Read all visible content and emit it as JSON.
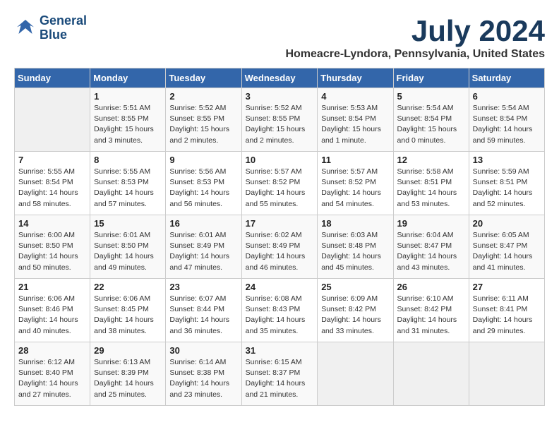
{
  "logo": {
    "line1": "General",
    "line2": "Blue"
  },
  "title": "July 2024",
  "location": "Homeacre-Lyndora, Pennsylvania, United States",
  "days_of_week": [
    "Sunday",
    "Monday",
    "Tuesday",
    "Wednesday",
    "Thursday",
    "Friday",
    "Saturday"
  ],
  "weeks": [
    [
      {
        "day": "",
        "info": ""
      },
      {
        "day": "1",
        "info": "Sunrise: 5:51 AM\nSunset: 8:55 PM\nDaylight: 15 hours\nand 3 minutes."
      },
      {
        "day": "2",
        "info": "Sunrise: 5:52 AM\nSunset: 8:55 PM\nDaylight: 15 hours\nand 2 minutes."
      },
      {
        "day": "3",
        "info": "Sunrise: 5:52 AM\nSunset: 8:55 PM\nDaylight: 15 hours\nand 2 minutes."
      },
      {
        "day": "4",
        "info": "Sunrise: 5:53 AM\nSunset: 8:54 PM\nDaylight: 15 hours\nand 1 minute."
      },
      {
        "day": "5",
        "info": "Sunrise: 5:54 AM\nSunset: 8:54 PM\nDaylight: 15 hours\nand 0 minutes."
      },
      {
        "day": "6",
        "info": "Sunrise: 5:54 AM\nSunset: 8:54 PM\nDaylight: 14 hours\nand 59 minutes."
      }
    ],
    [
      {
        "day": "7",
        "info": "Sunrise: 5:55 AM\nSunset: 8:54 PM\nDaylight: 14 hours\nand 58 minutes."
      },
      {
        "day": "8",
        "info": "Sunrise: 5:55 AM\nSunset: 8:53 PM\nDaylight: 14 hours\nand 57 minutes."
      },
      {
        "day": "9",
        "info": "Sunrise: 5:56 AM\nSunset: 8:53 PM\nDaylight: 14 hours\nand 56 minutes."
      },
      {
        "day": "10",
        "info": "Sunrise: 5:57 AM\nSunset: 8:52 PM\nDaylight: 14 hours\nand 55 minutes."
      },
      {
        "day": "11",
        "info": "Sunrise: 5:57 AM\nSunset: 8:52 PM\nDaylight: 14 hours\nand 54 minutes."
      },
      {
        "day": "12",
        "info": "Sunrise: 5:58 AM\nSunset: 8:51 PM\nDaylight: 14 hours\nand 53 minutes."
      },
      {
        "day": "13",
        "info": "Sunrise: 5:59 AM\nSunset: 8:51 PM\nDaylight: 14 hours\nand 52 minutes."
      }
    ],
    [
      {
        "day": "14",
        "info": "Sunrise: 6:00 AM\nSunset: 8:50 PM\nDaylight: 14 hours\nand 50 minutes."
      },
      {
        "day": "15",
        "info": "Sunrise: 6:01 AM\nSunset: 8:50 PM\nDaylight: 14 hours\nand 49 minutes."
      },
      {
        "day": "16",
        "info": "Sunrise: 6:01 AM\nSunset: 8:49 PM\nDaylight: 14 hours\nand 47 minutes."
      },
      {
        "day": "17",
        "info": "Sunrise: 6:02 AM\nSunset: 8:49 PM\nDaylight: 14 hours\nand 46 minutes."
      },
      {
        "day": "18",
        "info": "Sunrise: 6:03 AM\nSunset: 8:48 PM\nDaylight: 14 hours\nand 45 minutes."
      },
      {
        "day": "19",
        "info": "Sunrise: 6:04 AM\nSunset: 8:47 PM\nDaylight: 14 hours\nand 43 minutes."
      },
      {
        "day": "20",
        "info": "Sunrise: 6:05 AM\nSunset: 8:47 PM\nDaylight: 14 hours\nand 41 minutes."
      }
    ],
    [
      {
        "day": "21",
        "info": "Sunrise: 6:06 AM\nSunset: 8:46 PM\nDaylight: 14 hours\nand 40 minutes."
      },
      {
        "day": "22",
        "info": "Sunrise: 6:06 AM\nSunset: 8:45 PM\nDaylight: 14 hours\nand 38 minutes."
      },
      {
        "day": "23",
        "info": "Sunrise: 6:07 AM\nSunset: 8:44 PM\nDaylight: 14 hours\nand 36 minutes."
      },
      {
        "day": "24",
        "info": "Sunrise: 6:08 AM\nSunset: 8:43 PM\nDaylight: 14 hours\nand 35 minutes."
      },
      {
        "day": "25",
        "info": "Sunrise: 6:09 AM\nSunset: 8:42 PM\nDaylight: 14 hours\nand 33 minutes."
      },
      {
        "day": "26",
        "info": "Sunrise: 6:10 AM\nSunset: 8:42 PM\nDaylight: 14 hours\nand 31 minutes."
      },
      {
        "day": "27",
        "info": "Sunrise: 6:11 AM\nSunset: 8:41 PM\nDaylight: 14 hours\nand 29 minutes."
      }
    ],
    [
      {
        "day": "28",
        "info": "Sunrise: 6:12 AM\nSunset: 8:40 PM\nDaylight: 14 hours\nand 27 minutes."
      },
      {
        "day": "29",
        "info": "Sunrise: 6:13 AM\nSunset: 8:39 PM\nDaylight: 14 hours\nand 25 minutes."
      },
      {
        "day": "30",
        "info": "Sunrise: 6:14 AM\nSunset: 8:38 PM\nDaylight: 14 hours\nand 23 minutes."
      },
      {
        "day": "31",
        "info": "Sunrise: 6:15 AM\nSunset: 8:37 PM\nDaylight: 14 hours\nand 21 minutes."
      },
      {
        "day": "",
        "info": ""
      },
      {
        "day": "",
        "info": ""
      },
      {
        "day": "",
        "info": ""
      }
    ]
  ]
}
